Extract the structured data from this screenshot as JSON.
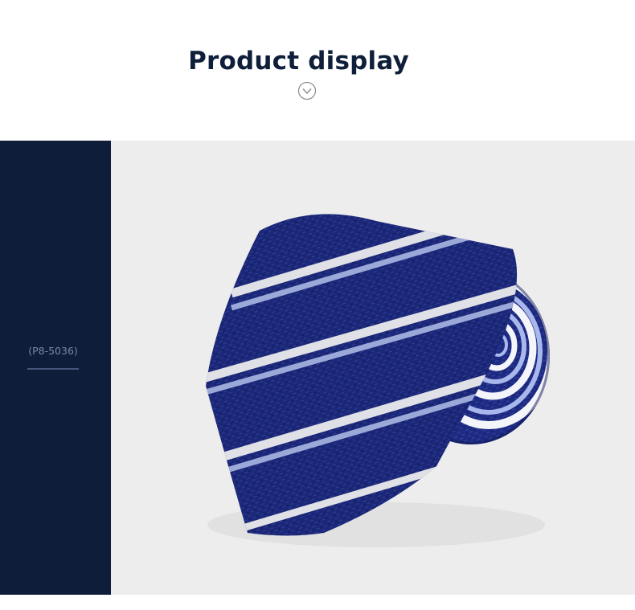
{
  "header": {
    "title": "Product display",
    "chevron_icon": "chevron-down-circle-icon"
  },
  "sidebar": {
    "product_code": "(P8-5036)"
  },
  "product_image": {
    "subject": "rolled-necktie",
    "colors": {
      "panel": "#0d1d3a",
      "tie_base": "#1d2a80",
      "stripe_white": "#f4f5fb",
      "stripe_light_blue": "#a9b8ec",
      "background": "#ededed"
    }
  }
}
